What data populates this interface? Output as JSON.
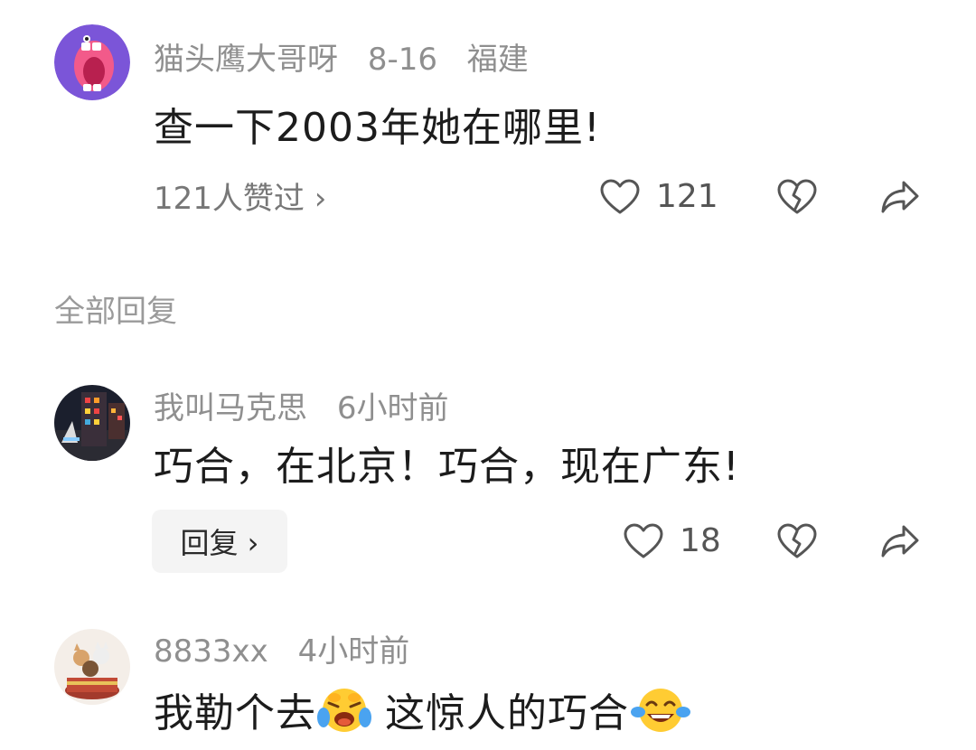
{
  "main_comment": {
    "username": "猫头鹰大哥呀",
    "time": "8-16",
    "location": "福建",
    "text": "查一下2003年她在哪里!",
    "likers_link": "121人赞过 ›",
    "like_count": "121"
  },
  "replies_section": {
    "title": "全部回复"
  },
  "replies": [
    {
      "username": "我叫马克思",
      "time": "6小时前",
      "text": "巧合，在北京！巧合，现在广东!",
      "reply_button": "回复 ›",
      "like_count": "18"
    },
    {
      "username": "8833xx",
      "time": "4小时前",
      "text_part1": "我勒个去",
      "emoji1": "laughing-crying-emoji",
      "text_part2": "这惊人的巧合",
      "emoji2": "tears-of-joy-emoji"
    }
  ],
  "icons": {
    "like": "heart-outline-icon",
    "dislike": "broken-heart-icon",
    "share": "share-arrow-icon"
  },
  "colors": {
    "meta_gray": "#8f8f8f",
    "icon_gray": "#555555",
    "avatar1_bg": "#7b55d8",
    "reply_button_bg": "#f4f4f4"
  }
}
